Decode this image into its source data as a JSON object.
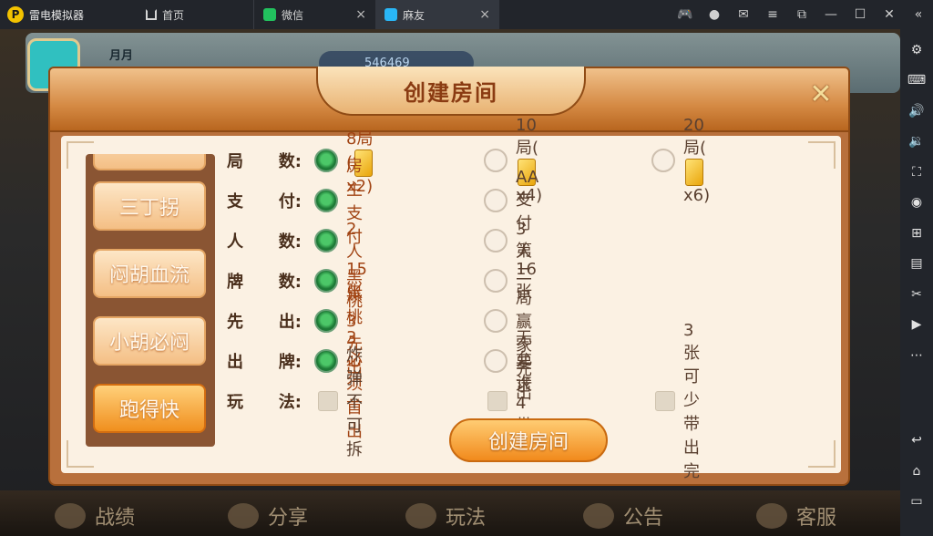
{
  "titlebar": {
    "app_name": "雷电模拟器",
    "logo_letter": "P",
    "tabs": [
      {
        "label": "首页"
      },
      {
        "label": "微信"
      },
      {
        "label": "麻友"
      }
    ],
    "tab_close_glyph": "×"
  },
  "game": {
    "username": "月月",
    "coins": "546469",
    "bottom_nav": [
      {
        "label": "战绩",
        "icon": "trophy-icon"
      },
      {
        "label": "分享",
        "icon": "share-icon"
      },
      {
        "label": "玩法",
        "icon": "rules-icon"
      },
      {
        "label": "公告",
        "icon": "mail-icon"
      },
      {
        "label": "客服",
        "icon": "headset-icon"
      }
    ]
  },
  "dialog": {
    "title": "创建房间",
    "modes": [
      "三丁拐",
      "闷胡血流",
      "小胡必闷",
      "跑得快"
    ],
    "selected_mode": "跑得快",
    "rows": [
      {
        "label": [
          "局",
          "数:"
        ],
        "options": [
          {
            "text": "8局(",
            "suffix": "x2)",
            "card": true,
            "selected": true
          },
          {
            "text": "10局(",
            "suffix": "x4)",
            "card": true,
            "selected": false
          },
          {
            "text": "20局(",
            "suffix": "x6)",
            "card": true,
            "selected": false
          }
        ]
      },
      {
        "label": [
          "支",
          "付:"
        ],
        "options": [
          {
            "text": "房主支付",
            "selected": true
          },
          {
            "text": "AA支付",
            "selected": false
          }
        ]
      },
      {
        "label": [
          "人",
          "数:"
        ],
        "options": [
          {
            "text": "2人",
            "selected": true
          },
          {
            "text": "3人",
            "selected": false
          }
        ]
      },
      {
        "label": [
          "牌",
          "数:"
        ],
        "options": [
          {
            "text": "15张",
            "selected": true
          },
          {
            "text": "16张",
            "selected": false
          }
        ]
      },
      {
        "label": [
          "先",
          "出:"
        ],
        "options": [
          {
            "text": "黑桃3先出",
            "selected": true
          },
          {
            "text": "第二局赢家先出",
            "selected": false
          }
        ]
      },
      {
        "label": [
          "出",
          "牌:"
        ],
        "options": [
          {
            "text": "黑桃3必须首出",
            "selected": true
          },
          {
            "text": "无要求",
            "selected": false
          }
        ]
      },
      {
        "label": [
          "玩",
          "法:"
        ],
        "checks": [
          {
            "text": "炸弹不可拆",
            "checked": false
          },
          {
            "text": "允许4带3",
            "checked": false
          },
          {
            "text": "3张可少带出完",
            "checked": false
          }
        ]
      }
    ],
    "create_button": "创建房间",
    "close_glyph": "✕"
  },
  "colors": {
    "accent_orange": "#f08f1e",
    "selected_green": "#1d7a36",
    "option_text": "#a14414"
  }
}
